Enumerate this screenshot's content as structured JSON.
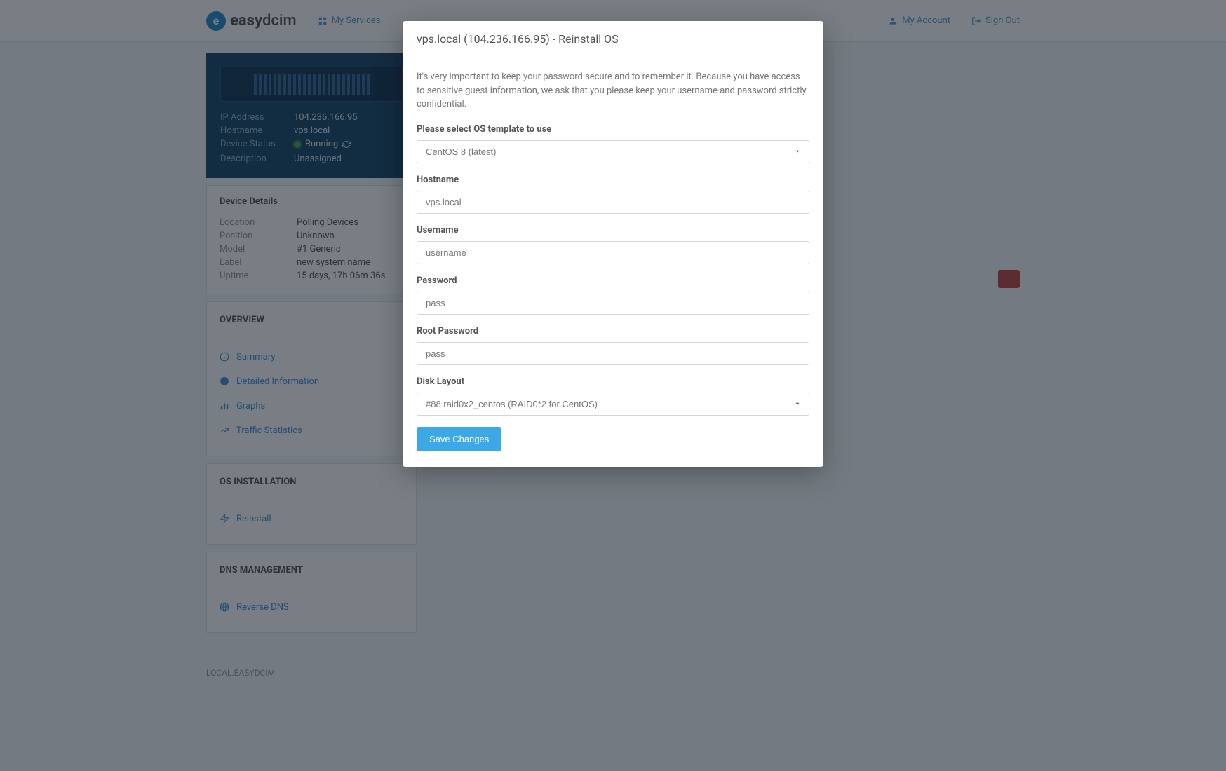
{
  "header": {
    "brand": "easydcim",
    "nav_my_services": "My Services",
    "nav_my_account": "My Account",
    "nav_sign_out": "Sign Out"
  },
  "device_info": {
    "labels": {
      "ip": "IP Address",
      "hostname": "Hostname",
      "status": "Device Status",
      "description": "Description"
    },
    "values": {
      "ip": "104.236.166.95",
      "hostname": "vps.local",
      "status": "Running",
      "description": "Unassigned"
    }
  },
  "details_panel": {
    "title": "Device Details",
    "labels": {
      "location": "Location",
      "position": "Position",
      "model": "Model",
      "label": "Label",
      "uptime": "Uptime"
    },
    "values": {
      "location": "Polling Devices",
      "position": "Unknown",
      "model": "#1 Generic",
      "label": "new system name",
      "uptime": "15 days, 17h 06m 36s"
    }
  },
  "overview_panel": {
    "title": "OVERVIEW",
    "items": {
      "summary": "Summary",
      "detailed": "Detailed Information",
      "graphs": "Graphs",
      "traffic": "Traffic Statistics"
    }
  },
  "os_panel": {
    "title": "OS INSTALLATION",
    "reinstall": "Reinstall"
  },
  "dns_panel": {
    "title": "DNS MANAGEMENT",
    "reverse": "Reverse DNS"
  },
  "footer": {
    "text": "LOCAL.EASYDCIM"
  },
  "modal": {
    "title": "vps.local (104.236.166.95) - Reinstall OS",
    "description": "It's very important to keep your password secure and to remember it. Because you have access to sensitive guest information, we ask that you please keep your username and password strictly confidential.",
    "labels": {
      "template": "Please select OS template to use",
      "hostname": "Hostname",
      "username": "Username",
      "password": "Password",
      "root_password": "Root Password",
      "disk_layout": "Disk Layout"
    },
    "values": {
      "template": "CentOS 8 (latest)",
      "hostname": "vps.local",
      "username": "username",
      "password": "pass",
      "root_password": "pass",
      "disk_layout": "#88 raid0x2_centos (RAID0*2 for CentOS)"
    },
    "save_button": "Save Changes"
  }
}
